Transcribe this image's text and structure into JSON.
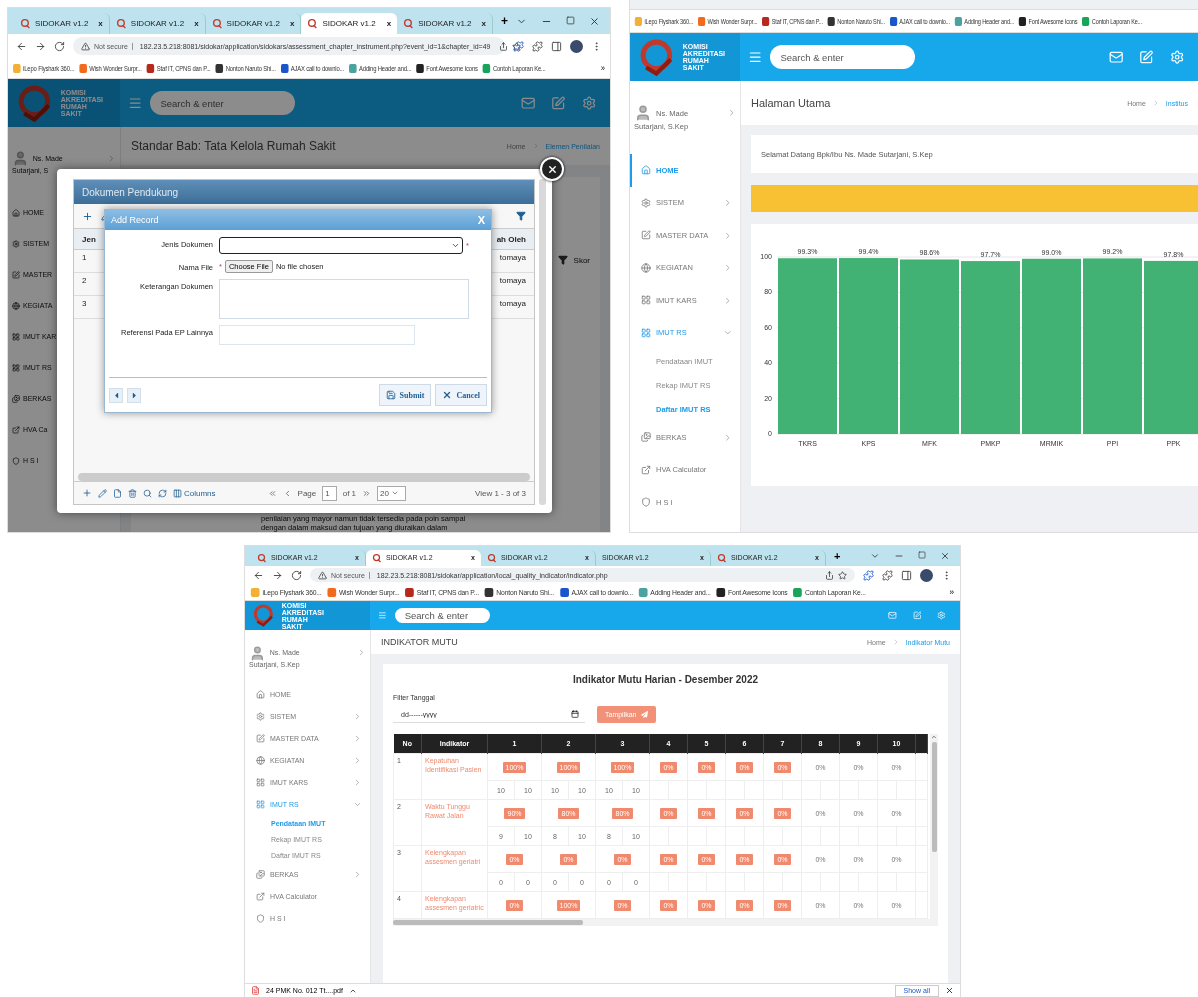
{
  "left_window": {
    "tabs": [
      {
        "title": "SIDOKAR v1.2",
        "icon": true,
        "close": "x",
        "selected": false
      },
      {
        "title": "SIDOKAR v1.2",
        "icon": true,
        "close": "x",
        "selected": false
      },
      {
        "title": "SIDOKAR v1.2",
        "icon": true,
        "close": "x",
        "selected": false
      },
      {
        "title": "SIDOKAR v1.2",
        "icon": true,
        "close": "x",
        "selected": true
      },
      {
        "title": "SIDOKAR v1.2",
        "icon": true,
        "close": "x",
        "selected": false
      }
    ],
    "new_tab": "+",
    "address": {
      "security": "Not secure",
      "url": "182.23.5.218:8081/sidokar/application/sidokars/assessment_chapter_instrument.php?event_id=1&chapter_id=49"
    },
    "bookmarks": [
      "iLepo Flyshark 360...",
      "Wish Wonder Surpr...",
      "Staf IT, CPNS dan P...",
      "Nonton Naruto Shi...",
      "AJAX call to downlo...",
      "Adding Header and...",
      "Font Awesome Icons",
      "Contoh Laporan Ke..."
    ],
    "bookmarks_more": "»",
    "logo_text": [
      "KOMISI",
      "AKREDITASI",
      "RUMAH",
      "SAKIT"
    ],
    "search": {
      "placeholder": "Search & enter"
    },
    "user": {
      "name": "Ns. Made",
      "name_line2": "Sutarjani, S"
    },
    "sidebar": [
      {
        "label": "HOME"
      },
      {
        "label": "SISTEM"
      },
      {
        "label": "MASTER"
      },
      {
        "label": "KEGIATA"
      },
      {
        "label": "IMUT KAR"
      },
      {
        "label": "IMUT RS"
      },
      {
        "label": "BERKAS"
      },
      {
        "label": "HVA Ca"
      },
      {
        "label": "H S I"
      }
    ],
    "page_title": "Standar Bab: Tata Kelola Rumah Sakit",
    "breadcrumb": [
      "Home",
      "Elemen Penilaian"
    ],
    "side_column": "Skor",
    "page_text": [
      "penilaian yang mayor namun tidak tersedia pada poin sampai",
      "dengan dalam maksud dan tujuan yang diuraikan dalam"
    ],
    "grid": {
      "title": "Dokumen Pendukung",
      "columns": [
        "Jen",
        "ah Oleh"
      ],
      "rows": [
        {
          "no": "1",
          "by": "tomaya"
        },
        {
          "no": "2",
          "by": "tomaya"
        },
        {
          "no": "3",
          "by": "tomaya"
        }
      ],
      "pager": {
        "columns_label": "Columns",
        "page_label": "Page",
        "page": "1",
        "of": "of 1",
        "per_page": "20",
        "view": "View 1 - 3 of 3"
      }
    },
    "dialog": {
      "title": "Add Record",
      "close": "X",
      "fields": [
        {
          "kind": "select",
          "label": "Jenis Dokumen",
          "required_mark": "*"
        },
        {
          "kind": "file",
          "label": "Nama File",
          "required_mark": "*",
          "button": "Choose File",
          "status": "No file chosen"
        },
        {
          "kind": "textarea",
          "label": "Keterangan Dokumen"
        },
        {
          "kind": "text",
          "label": "Referensi Pada EP Lainnya"
        }
      ],
      "buttons": [
        "Submit",
        "Cancel"
      ]
    }
  },
  "right_window": {
    "bookmarks": [
      "iLepo Flyshark 360...",
      "Wish Wonder Surpr...",
      "Staf IT, CPNS dan P...",
      "Nonton Naruto Shi...",
      "AJAX call to downlo...",
      "Adding Header and...",
      "Font Awesome Icons",
      "Contoh Laporan Ke..."
    ],
    "logo_text": [
      "KOMISI",
      "AKREDITASI",
      "RUMAH",
      "SAKIT"
    ],
    "search": {
      "placeholder": "Search & enter"
    },
    "user": {
      "name": "Ns. Made",
      "name_line2": "Sutarjani, S.Kep"
    },
    "sidebar": [
      {
        "label": "HOME",
        "selected": true
      },
      {
        "label": "SISTEM",
        "expanded": false
      },
      {
        "label": "MASTER DATA",
        "expanded": false
      },
      {
        "label": "KEGIATAN",
        "expanded": false
      },
      {
        "label": "IMUT KARS",
        "expanded": false
      },
      {
        "label": "IMUT RS",
        "expanded": true,
        "children": [
          {
            "label": "Pendataan IMUT",
            "selected": false
          },
          {
            "label": "Rekap IMUT RS",
            "selected": false
          },
          {
            "label": "Daftar IMUT RS",
            "selected": true
          }
        ]
      },
      {
        "label": "BERKAS",
        "expanded": false
      },
      {
        "label": "HVA Calculator"
      },
      {
        "label": "H S I"
      }
    ],
    "page_title": "Halaman Utama",
    "breadcrumb": [
      "Home",
      "Institus"
    ],
    "welcome": "Selamat Datang Bpk/Ibu Ns. Made Sutarjani, S.Kep",
    "chart_data": {
      "type": "bar",
      "categories": [
        "TKRS",
        "KPS",
        "MFK",
        "PMKP",
        "MRMIK",
        "PPI",
        "PPK"
      ],
      "values": [
        99.3,
        99.4,
        98.6,
        97.7,
        99.0,
        99.2,
        97.8
      ],
      "grid": true,
      "value_labels": [
        "99.3%",
        "99.4%",
        "98.6%",
        "97.7%",
        "99.0%",
        "99.2%",
        "97.8%"
      ],
      "ylim": [
        0,
        100
      ],
      "yticks": [
        0,
        20,
        40,
        60,
        80,
        100
      ]
    }
  },
  "bottom_window": {
    "tabs": [
      {
        "title": "SIDOKAR v1.2",
        "icon": true,
        "close": "x",
        "selected": false
      },
      {
        "title": "SIDOKAR v1.2",
        "icon": true,
        "close": "x",
        "selected": true
      },
      {
        "title": "SIDOKAR v1.2",
        "icon": true,
        "close": "x",
        "selected": false
      },
      {
        "title": "SIDOKAR v1.2",
        "icon": false,
        "close": "x",
        "selected": false
      },
      {
        "title": "SIDOKAR v1.2",
        "icon": true,
        "close": "x",
        "selected": false
      }
    ],
    "new_tab": "+",
    "address": {
      "security": "Not secure",
      "url": "182.23.5.218:8081/sidokar/application/local_quality_indicator/indicator.php"
    },
    "bookmarks": [
      "iLepo Flyshark 360...",
      "Wish Wonder Surpr...",
      "Staf IT, CPNS dan P...",
      "Nonton Naruto Shi...",
      "AJAX call to downlo...",
      "Adding Header and...",
      "Font Awesome Icons",
      "Contoh Laporan Ke..."
    ],
    "bookmarks_more": "»",
    "logo_text": [
      "KOMISI",
      "AKREDITASI",
      "RUMAH",
      "SAKIT"
    ],
    "search": {
      "placeholder": "Search & enter"
    },
    "user": {
      "name": "Ns. Made",
      "name_line2": "Sutarjani, S.Kep"
    },
    "sidebar": [
      {
        "label": "HOME",
        "selected": false
      },
      {
        "label": "SISTEM",
        "expanded": false
      },
      {
        "label": "MASTER DATA",
        "expanded": false
      },
      {
        "label": "KEGIATAN",
        "expanded": false
      },
      {
        "label": "IMUT KARS",
        "expanded": false
      },
      {
        "label": "IMUT RS",
        "expanded": true,
        "children": [
          {
            "label": "Pendataan IMUT",
            "selected": true
          },
          {
            "label": "Rekap IMUT RS",
            "selected": false
          },
          {
            "label": "Daftar IMUT RS",
            "selected": false
          }
        ]
      },
      {
        "label": "BERKAS",
        "expanded": false
      },
      {
        "label": "HVA Calculator"
      },
      {
        "label": "H S I"
      }
    ],
    "page_title": "INDIKATOR MUTU",
    "breadcrumb": [
      "Home",
      "Indikator Mutu"
    ],
    "card": {
      "title": "Indikator Mutu Harian - Desember 2022",
      "filter_label": "Filter Tanggal",
      "date": {
        "placeholder": "dd------yyyy"
      },
      "button": "Tampilkan"
    },
    "table": {
      "columns": [
        "No",
        "Indikator",
        "1",
        "2",
        "3",
        "4",
        "5",
        "6",
        "7",
        "8",
        "9",
        "10"
      ],
      "rows": [
        {
          "no": "1",
          "indikator": "Kepatuhan Identifikasi Pasien",
          "days": [
            {
              "text": "100%",
              "badge": true
            },
            {
              "text": "100%",
              "badge": true
            },
            {
              "text": "100%",
              "badge": true
            },
            {
              "text": "0%",
              "badge": true
            },
            {
              "text": "0%",
              "badge": true
            },
            {
              "text": "0%",
              "badge": true
            },
            {
              "text": "0%",
              "badge": true
            },
            {
              "text": "0%",
              "badge": false
            },
            {
              "text": "0%",
              "badge": false
            },
            {
              "text": "0%",
              "badge": false
            }
          ],
          "counts": [
            "10",
            "10",
            "10",
            "10",
            "10",
            "10"
          ]
        },
        {
          "no": "2",
          "indikator": "Waktu Tunggu Rawat Jalan",
          "days": [
            {
              "text": "90%",
              "badge": true
            },
            {
              "text": "80%",
              "badge": true
            },
            {
              "text": "80%",
              "badge": true
            },
            {
              "text": "0%",
              "badge": true
            },
            {
              "text": "0%",
              "badge": true
            },
            {
              "text": "0%",
              "badge": true
            },
            {
              "text": "0%",
              "badge": true
            },
            {
              "text": "0%",
              "badge": false
            },
            {
              "text": "0%",
              "badge": false
            },
            {
              "text": "0%",
              "badge": false
            }
          ],
          "counts": [
            "9",
            "10",
            "8",
            "10",
            "8",
            "10"
          ]
        },
        {
          "no": "3",
          "indikator": "Kelengkapan assesmen geriatri",
          "days": [
            {
              "text": "0%",
              "badge": true
            },
            {
              "text": "0%",
              "badge": true
            },
            {
              "text": "0%",
              "badge": true
            },
            {
              "text": "0%",
              "badge": true
            },
            {
              "text": "0%",
              "badge": true
            },
            {
              "text": "0%",
              "badge": true
            },
            {
              "text": "0%",
              "badge": true
            },
            {
              "text": "0%",
              "badge": false
            },
            {
              "text": "0%",
              "badge": false
            },
            {
              "text": "0%",
              "badge": false
            }
          ],
          "counts": [
            "0",
            "0",
            "0",
            "0",
            "0",
            "0"
          ]
        },
        {
          "no": "4",
          "indikator": "Kelengkapan assesmen geriatric",
          "days": [
            {
              "text": "0%",
              "badge": true
            },
            {
              "text": "100%",
              "badge": true
            },
            {
              "text": "0%",
              "badge": true
            },
            {
              "text": "0%",
              "badge": true
            },
            {
              "text": "0%",
              "badge": true
            },
            {
              "text": "0%",
              "badge": true
            },
            {
              "text": "0%",
              "badge": true
            },
            {
              "text": "0%",
              "badge": false
            },
            {
              "text": "0%",
              "badge": false
            },
            {
              "text": "0%",
              "badge": false
            }
          ]
        }
      ]
    },
    "download": {
      "file": "24 PMK No. 012 Tt....pdf",
      "show_all": "Show all"
    }
  }
}
